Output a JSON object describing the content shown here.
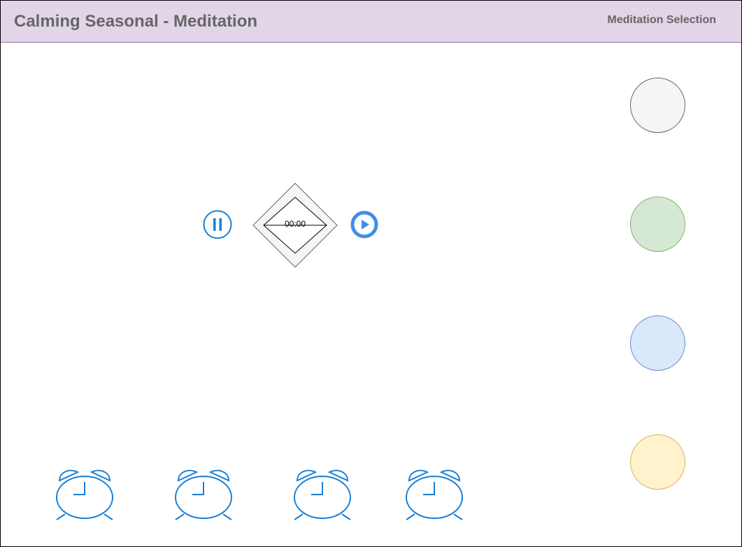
{
  "header": {
    "title": "Calming Seasonal - Meditation",
    "nav_link": "Meditation Selection"
  },
  "player": {
    "pause_icon": "pause-circle-icon",
    "play_icon": "play-circle-icon",
    "timer_text": "00:00"
  },
  "season_circles": [
    {
      "fill": "#f5f5f5",
      "stroke": "#666666"
    },
    {
      "fill": "#d5e8d4",
      "stroke": "#82b366"
    },
    {
      "fill": "#dae8fc",
      "stroke": "#6c8ebf"
    },
    {
      "fill": "#fff2cc",
      "stroke": "#d6b656"
    }
  ],
  "alarms": [
    {
      "icon": "alarm-clock-icon"
    },
    {
      "icon": "alarm-clock-icon"
    },
    {
      "icon": "alarm-clock-icon"
    },
    {
      "icon": "alarm-clock-icon"
    }
  ],
  "colors": {
    "accent": "#1a7fd4",
    "play_accent": "#3d8fe8",
    "header_bg": "#e1d5e7",
    "header_border": "#9673a6"
  }
}
